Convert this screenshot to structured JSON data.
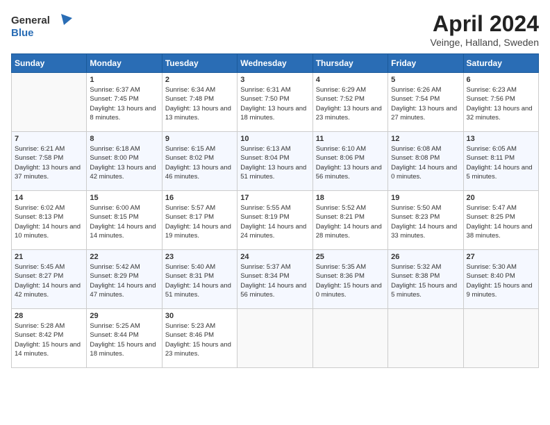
{
  "header": {
    "logo_general": "General",
    "logo_blue": "Blue",
    "title": "April 2024",
    "subtitle": "Veinge, Halland, Sweden"
  },
  "columns": [
    "Sunday",
    "Monday",
    "Tuesday",
    "Wednesday",
    "Thursday",
    "Friday",
    "Saturday"
  ],
  "weeks": [
    [
      {
        "day": "",
        "empty": true
      },
      {
        "day": "1",
        "sunrise": "Sunrise: 6:37 AM",
        "sunset": "Sunset: 7:45 PM",
        "daylight": "Daylight: 13 hours and 8 minutes."
      },
      {
        "day": "2",
        "sunrise": "Sunrise: 6:34 AM",
        "sunset": "Sunset: 7:48 PM",
        "daylight": "Daylight: 13 hours and 13 minutes."
      },
      {
        "day": "3",
        "sunrise": "Sunrise: 6:31 AM",
        "sunset": "Sunset: 7:50 PM",
        "daylight": "Daylight: 13 hours and 18 minutes."
      },
      {
        "day": "4",
        "sunrise": "Sunrise: 6:29 AM",
        "sunset": "Sunset: 7:52 PM",
        "daylight": "Daylight: 13 hours and 23 minutes."
      },
      {
        "day": "5",
        "sunrise": "Sunrise: 6:26 AM",
        "sunset": "Sunset: 7:54 PM",
        "daylight": "Daylight: 13 hours and 27 minutes."
      },
      {
        "day": "6",
        "sunrise": "Sunrise: 6:23 AM",
        "sunset": "Sunset: 7:56 PM",
        "daylight": "Daylight: 13 hours and 32 minutes."
      }
    ],
    [
      {
        "day": "7",
        "sunrise": "Sunrise: 6:21 AM",
        "sunset": "Sunset: 7:58 PM",
        "daylight": "Daylight: 13 hours and 37 minutes."
      },
      {
        "day": "8",
        "sunrise": "Sunrise: 6:18 AM",
        "sunset": "Sunset: 8:00 PM",
        "daylight": "Daylight: 13 hours and 42 minutes."
      },
      {
        "day": "9",
        "sunrise": "Sunrise: 6:15 AM",
        "sunset": "Sunset: 8:02 PM",
        "daylight": "Daylight: 13 hours and 46 minutes."
      },
      {
        "day": "10",
        "sunrise": "Sunrise: 6:13 AM",
        "sunset": "Sunset: 8:04 PM",
        "daylight": "Daylight: 13 hours and 51 minutes."
      },
      {
        "day": "11",
        "sunrise": "Sunrise: 6:10 AM",
        "sunset": "Sunset: 8:06 PM",
        "daylight": "Daylight: 13 hours and 56 minutes."
      },
      {
        "day": "12",
        "sunrise": "Sunrise: 6:08 AM",
        "sunset": "Sunset: 8:08 PM",
        "daylight": "Daylight: 14 hours and 0 minutes."
      },
      {
        "day": "13",
        "sunrise": "Sunrise: 6:05 AM",
        "sunset": "Sunset: 8:11 PM",
        "daylight": "Daylight: 14 hours and 5 minutes."
      }
    ],
    [
      {
        "day": "14",
        "sunrise": "Sunrise: 6:02 AM",
        "sunset": "Sunset: 8:13 PM",
        "daylight": "Daylight: 14 hours and 10 minutes."
      },
      {
        "day": "15",
        "sunrise": "Sunrise: 6:00 AM",
        "sunset": "Sunset: 8:15 PM",
        "daylight": "Daylight: 14 hours and 14 minutes."
      },
      {
        "day": "16",
        "sunrise": "Sunrise: 5:57 AM",
        "sunset": "Sunset: 8:17 PM",
        "daylight": "Daylight: 14 hours and 19 minutes."
      },
      {
        "day": "17",
        "sunrise": "Sunrise: 5:55 AM",
        "sunset": "Sunset: 8:19 PM",
        "daylight": "Daylight: 14 hours and 24 minutes."
      },
      {
        "day": "18",
        "sunrise": "Sunrise: 5:52 AM",
        "sunset": "Sunset: 8:21 PM",
        "daylight": "Daylight: 14 hours and 28 minutes."
      },
      {
        "day": "19",
        "sunrise": "Sunrise: 5:50 AM",
        "sunset": "Sunset: 8:23 PM",
        "daylight": "Daylight: 14 hours and 33 minutes."
      },
      {
        "day": "20",
        "sunrise": "Sunrise: 5:47 AM",
        "sunset": "Sunset: 8:25 PM",
        "daylight": "Daylight: 14 hours and 38 minutes."
      }
    ],
    [
      {
        "day": "21",
        "sunrise": "Sunrise: 5:45 AM",
        "sunset": "Sunset: 8:27 PM",
        "daylight": "Daylight: 14 hours and 42 minutes."
      },
      {
        "day": "22",
        "sunrise": "Sunrise: 5:42 AM",
        "sunset": "Sunset: 8:29 PM",
        "daylight": "Daylight: 14 hours and 47 minutes."
      },
      {
        "day": "23",
        "sunrise": "Sunrise: 5:40 AM",
        "sunset": "Sunset: 8:31 PM",
        "daylight": "Daylight: 14 hours and 51 minutes."
      },
      {
        "day": "24",
        "sunrise": "Sunrise: 5:37 AM",
        "sunset": "Sunset: 8:34 PM",
        "daylight": "Daylight: 14 hours and 56 minutes."
      },
      {
        "day": "25",
        "sunrise": "Sunrise: 5:35 AM",
        "sunset": "Sunset: 8:36 PM",
        "daylight": "Daylight: 15 hours and 0 minutes."
      },
      {
        "day": "26",
        "sunrise": "Sunrise: 5:32 AM",
        "sunset": "Sunset: 8:38 PM",
        "daylight": "Daylight: 15 hours and 5 minutes."
      },
      {
        "day": "27",
        "sunrise": "Sunrise: 5:30 AM",
        "sunset": "Sunset: 8:40 PM",
        "daylight": "Daylight: 15 hours and 9 minutes."
      }
    ],
    [
      {
        "day": "28",
        "sunrise": "Sunrise: 5:28 AM",
        "sunset": "Sunset: 8:42 PM",
        "daylight": "Daylight: 15 hours and 14 minutes."
      },
      {
        "day": "29",
        "sunrise": "Sunrise: 5:25 AM",
        "sunset": "Sunset: 8:44 PM",
        "daylight": "Daylight: 15 hours and 18 minutes."
      },
      {
        "day": "30",
        "sunrise": "Sunrise: 5:23 AM",
        "sunset": "Sunset: 8:46 PM",
        "daylight": "Daylight: 15 hours and 23 minutes."
      },
      {
        "day": "",
        "empty": true
      },
      {
        "day": "",
        "empty": true
      },
      {
        "day": "",
        "empty": true
      },
      {
        "day": "",
        "empty": true
      }
    ]
  ]
}
